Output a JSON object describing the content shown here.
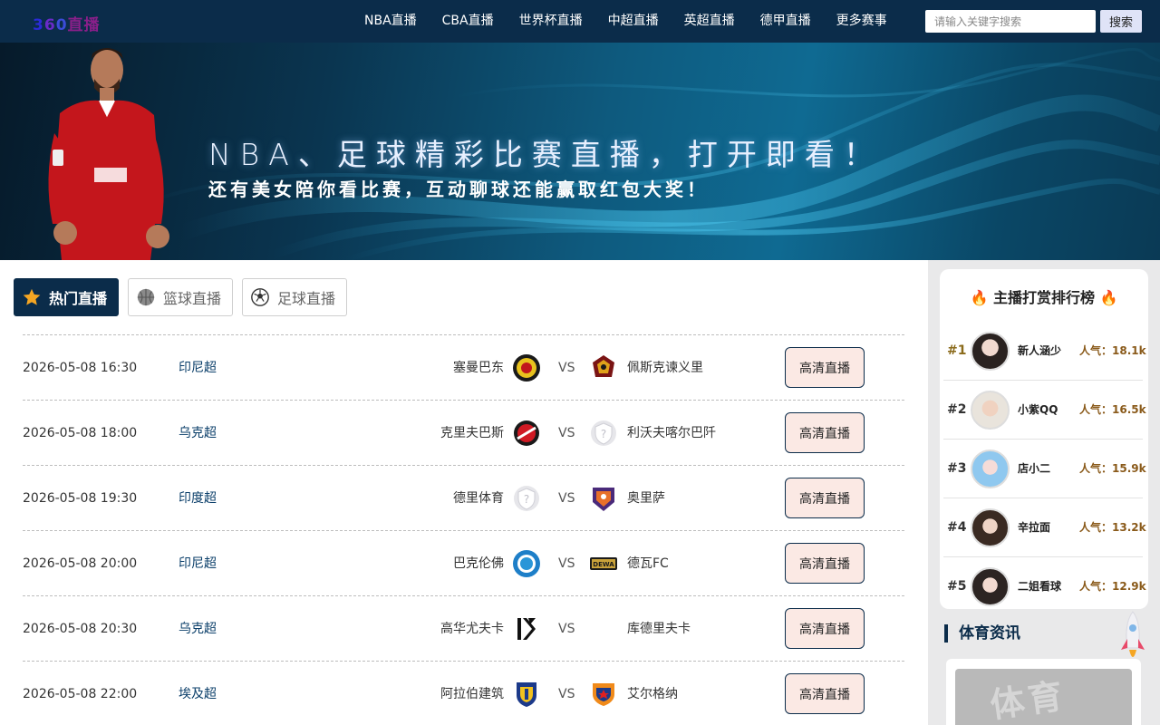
{
  "header": {
    "logo": {
      "c1": "3",
      "c2": "6",
      "c3": "0",
      "c4": "直播"
    },
    "nav": [
      "NBA直播",
      "CBA直播",
      "世界杯直播",
      "中超直播",
      "英超直播",
      "德甲直播",
      "更多赛事"
    ],
    "search_placeholder": "请输入关键字搜索",
    "search_button": "搜索"
  },
  "banner": {
    "headline": "NBA、足球精彩比赛直播，打开即看！",
    "subline": "还有美女陪你看比赛，互动聊球还能赢取红包大奖！"
  },
  "tabs": [
    {
      "label": "热门直播",
      "icon": "star-icon",
      "active": true
    },
    {
      "label": "篮球直播",
      "icon": "basketball-icon",
      "active": false
    },
    {
      "label": "足球直播",
      "icon": "soccer-ball-icon",
      "active": false
    }
  ],
  "matches": [
    {
      "time": "2026-05-08 16:30",
      "league": "印尼超",
      "home": "塞曼巴东",
      "away": "佩斯克谏义里",
      "vs": "VS",
      "button": "高清直播"
    },
    {
      "time": "2026-05-08 18:00",
      "league": "乌克超",
      "home": "克里夫巴斯",
      "away": "利沃夫喀尔巴阡",
      "vs": "VS",
      "button": "高清直播"
    },
    {
      "time": "2026-05-08 19:30",
      "league": "印度超",
      "home": "德里体育",
      "away": "奥里萨",
      "vs": "VS",
      "button": "高清直播"
    },
    {
      "time": "2026-05-08 20:00",
      "league": "印尼超",
      "home": "巴克伦佛",
      "away": "德瓦FC",
      "vs": "VS",
      "button": "高清直播"
    },
    {
      "time": "2026-05-08 20:30",
      "league": "乌克超",
      "home": "高华尤夫卡",
      "away": "库德里夫卡",
      "vs": "VS",
      "button": "高清直播"
    },
    {
      "time": "2026-05-08 22:00",
      "league": "埃及超",
      "home": "阿拉伯建筑",
      "away": "艾尔格纳",
      "vs": "VS",
      "button": "高清直播"
    }
  ],
  "ranking": {
    "title": "主播打赏排行榜",
    "items": [
      {
        "no": "#1",
        "name": "新人涵少",
        "pop": "人气：18.1k"
      },
      {
        "no": "#2",
        "name": "小紫QQ",
        "pop": "人气：16.5k"
      },
      {
        "no": "#3",
        "name": "店小二",
        "pop": "人气：15.9k"
      },
      {
        "no": "#4",
        "name": "辛拉面",
        "pop": "人气：13.2k"
      },
      {
        "no": "#5",
        "name": "二姐看球",
        "pop": "人气：12.9k"
      }
    ]
  },
  "news": {
    "title": "体育资讯",
    "image_text": "体育"
  }
}
